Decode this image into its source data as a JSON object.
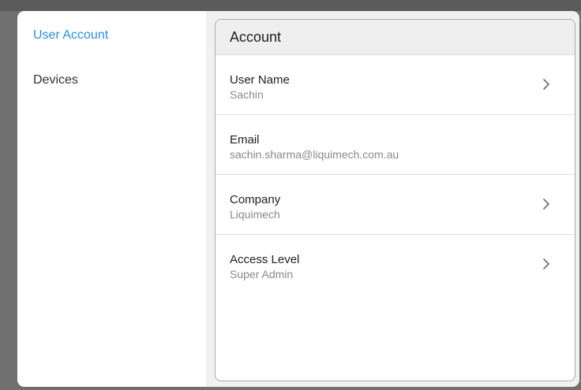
{
  "sidebar": {
    "items": [
      {
        "label": "User Account",
        "active": true
      },
      {
        "label": "Devices",
        "active": false
      }
    ]
  },
  "card": {
    "title": "Account",
    "rows": [
      {
        "label": "User Name",
        "value": "Sachin",
        "chevron": "chevron-right-icon"
      },
      {
        "label": "Email",
        "value": "sachin.sharma@liquimech.com.au"
      },
      {
        "label": "Company",
        "value": "Liquimech",
        "chevron": "chevron-right-icon"
      },
      {
        "label": "Access Level",
        "value": "Super Admin",
        "chevron": "chevron-right-icon"
      }
    ]
  },
  "colors": {
    "accent": "#2b8fe0",
    "backdrop": "#707070",
    "panel": "#f1f1f1"
  }
}
